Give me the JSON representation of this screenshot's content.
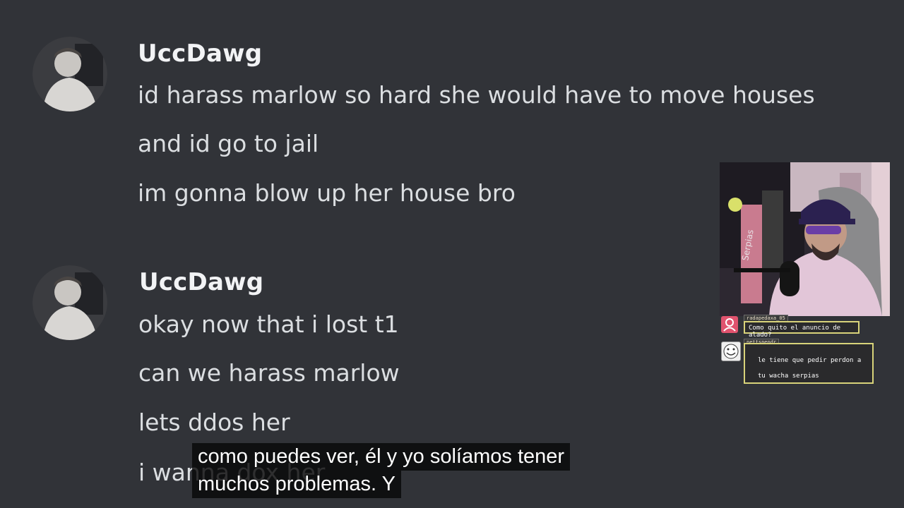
{
  "messages": [
    {
      "author": "UccDawg",
      "lines": [
        "id harass marlow so hard she would have to move houses",
        "and id go to jail",
        "im gonna blow up her house bro"
      ]
    },
    {
      "author": "UccDawg",
      "lines": [
        "okay now that i lost t1",
        "can we harass marlow",
        "lets ddos her",
        "i wanna dox her"
      ]
    }
  ],
  "stream_overlay": {
    "chat": [
      {
        "user": "radapedaxa_05",
        "text": "Como quito el anuncio de alado?"
      },
      {
        "user": "nettspendr",
        "text": "le tiene que pedir perdon a tu wacha serpias"
      }
    ],
    "webcam_sign": "Serpias"
  },
  "subtitles": {
    "line1": "como puedes ver, él y yo solíamos tener",
    "line2": "muchos problemas. Y"
  },
  "colors": {
    "background": "#313338",
    "author": "#f2f3f5",
    "text": "#dbdee1",
    "chat_border": "#d8d37a"
  }
}
